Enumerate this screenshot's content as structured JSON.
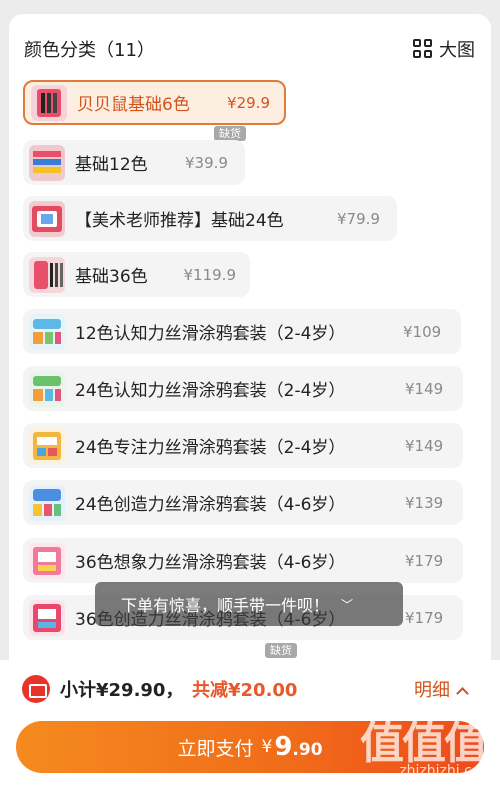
{
  "header": {
    "title": "颜色分类（11）",
    "view_label": "大图"
  },
  "options": [
    {
      "name": "贝贝鼠基础6色",
      "price": "¥29.9",
      "selected": true,
      "badge": "缺货"
    },
    {
      "name": "基础12色",
      "price": "¥39.9",
      "selected": false,
      "badge": ""
    },
    {
      "name": "【美术老师推荐】基础24色",
      "price": "¥79.9",
      "selected": false,
      "badge": ""
    },
    {
      "name": "基础36色",
      "price": "¥119.9",
      "selected": false,
      "badge": ""
    },
    {
      "name": "12色认知力丝滑涂鸦套装（2-4岁）",
      "price": "¥109",
      "selected": false,
      "badge": ""
    },
    {
      "name": "24色认知力丝滑涂鸦套装（2-4岁）",
      "price": "¥149",
      "selected": false,
      "badge": ""
    },
    {
      "name": "24色专注力丝滑涂鸦套装（2-4岁）",
      "price": "¥149",
      "selected": false,
      "badge": ""
    },
    {
      "name": "24色创造力丝滑涂鸦套装（4-6岁）",
      "price": "¥139",
      "selected": false,
      "badge": ""
    },
    {
      "name": "36色想象力丝滑涂鸦套装（4-6岁）",
      "price": "¥179",
      "selected": false,
      "badge": ""
    },
    {
      "name": "36色创造力丝滑涂鸦套装（4-6岁）",
      "price": "¥179",
      "selected": false,
      "badge": "缺货"
    }
  ],
  "toast": {
    "text": "下单有惊喜，顺手带一件呗！"
  },
  "footer": {
    "subtotal": "小计¥29.90，",
    "discount": "共减¥20.00",
    "detail_label": "明细",
    "pay_label": "立即支付",
    "pay_currency": "¥",
    "pay_int": "9",
    "pay_dec": ".90"
  },
  "watermark": {
    "logo": "值值值",
    "url": "zhizhizhi.com"
  },
  "colors": {
    "accent": "#e07a3d",
    "price_red": "#d2541c",
    "pay_start": "#f58a1e",
    "pay_end": "#ef4a1b",
    "badge_gray": "#a8a8a8"
  }
}
